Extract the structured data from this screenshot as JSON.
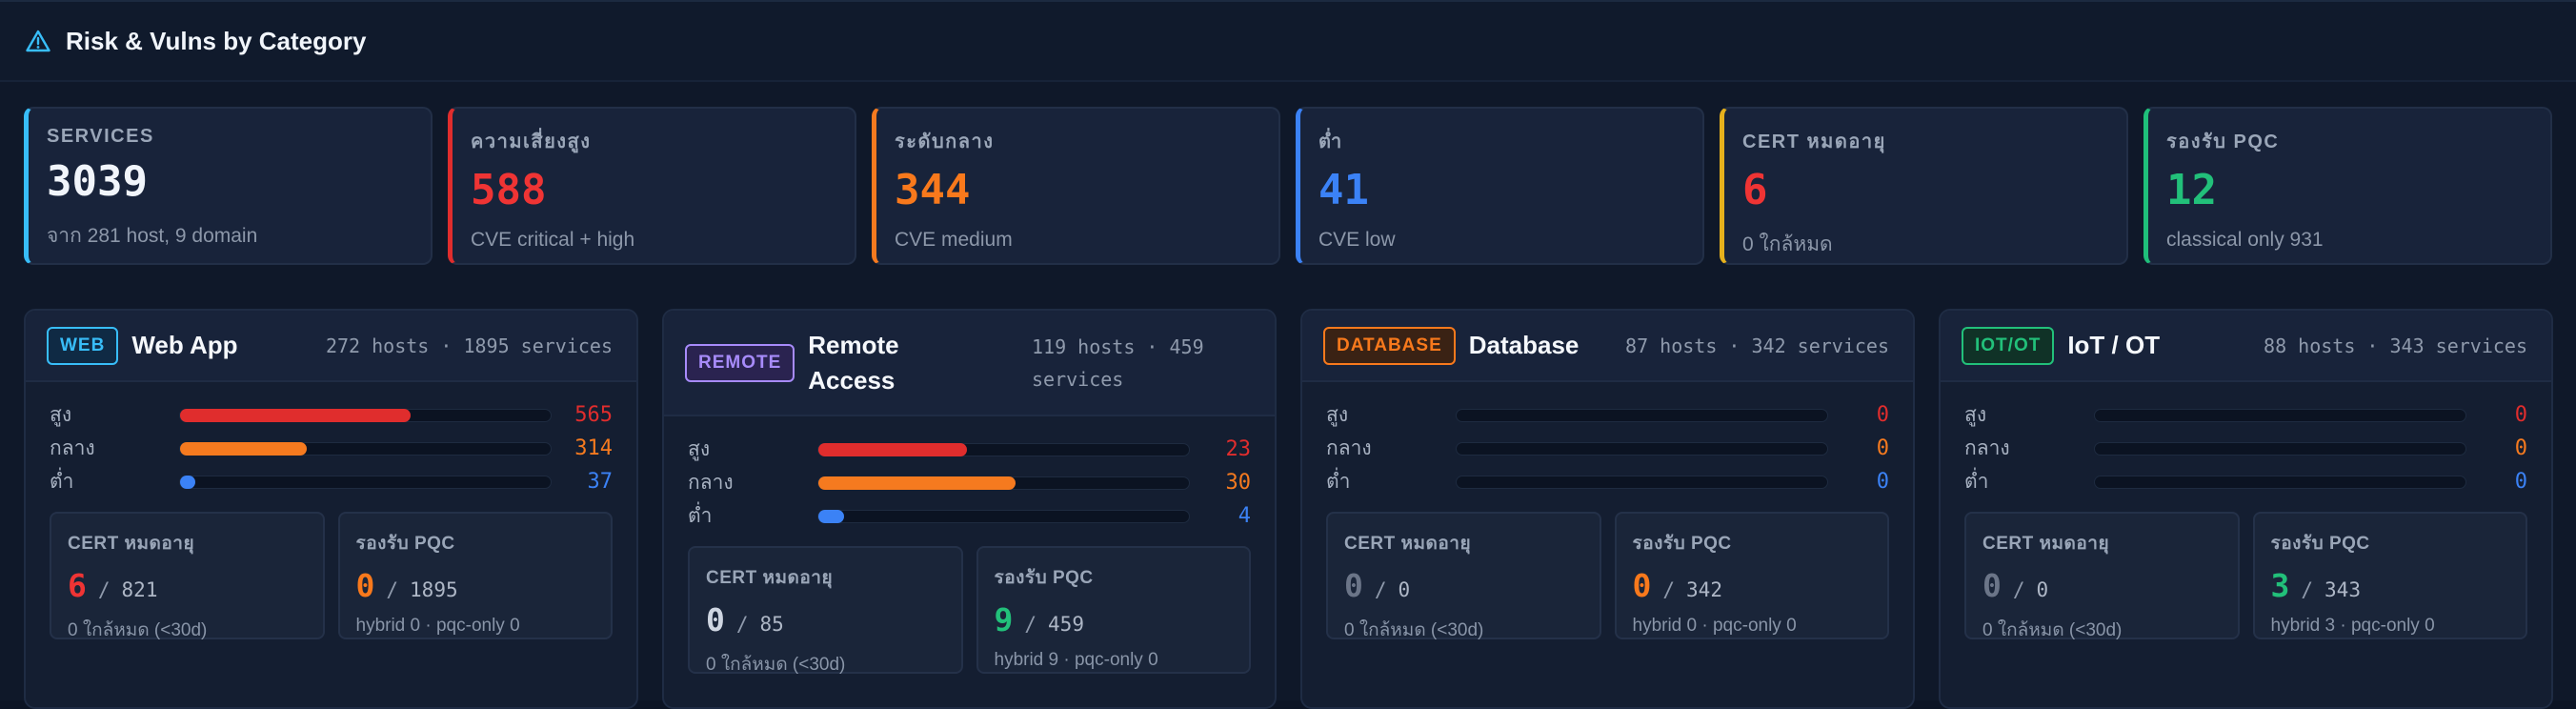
{
  "header": {
    "title": "Risk & Vulns by Category",
    "icon": "warning-triangle-icon"
  },
  "colors": {
    "accent_blue": "#2f9be6",
    "high": "#e02d2d",
    "medium": "#f57a1f",
    "low": "#3b82f6",
    "cert": "#e6b11c",
    "pqc": "#22c07a"
  },
  "stats": [
    {
      "label": "SERVICES",
      "value": "3039",
      "sub": "จาก 281 host, 9 domain",
      "color": "#38bdf8",
      "value_color": "#f1f5fb"
    },
    {
      "label": "ความเสี่ยงสูง",
      "value": "588",
      "sub": "CVE critical + high",
      "color": "#e02d2d",
      "value_color": "#ef3434"
    },
    {
      "label": "ระดับกลาง",
      "value": "344",
      "sub": "CVE medium",
      "color": "#f57a1f",
      "value_color": "#f8791c"
    },
    {
      "label": "ต่ำ",
      "value": "41",
      "sub": "CVE low",
      "color": "#3b82f6",
      "value_color": "#3b82f6"
    },
    {
      "label": "CERT หมดอายุ",
      "value": "6",
      "sub": "0 ใกล้หมด",
      "color": "#e6b11c",
      "value_color": "#ef3434"
    },
    {
      "label": "รองรับ PQC",
      "value": "12",
      "sub": "classical only 931",
      "color": "#1fbf7a",
      "value_color": "#22c07a"
    }
  ],
  "cards": [
    {
      "badge": "WEB",
      "badge_color": "#38bdf8",
      "badge_bg": "#0f2a44",
      "title": "Web App",
      "meta": "272 hosts · 1895 services",
      "bars": [
        {
          "label": "สูง",
          "value": "565",
          "fraction": 0.62
        },
        {
          "label": "กลาง",
          "value": "314",
          "fraction": 0.34
        },
        {
          "label": "ต่ำ",
          "value": "37",
          "fraction": 0.04
        }
      ],
      "cert": {
        "label": "CERT หมดอายุ",
        "count": "6",
        "total": "821",
        "sub": "0 ใกล้หมด (<30d)",
        "color": "#ef3434"
      },
      "pqc": {
        "label": "รองรับ PQC",
        "count": "0",
        "total": "1895",
        "sub": "hybrid 0 · pqc-only 0",
        "color": "#f8791c"
      }
    },
    {
      "badge": "REMOTE",
      "badge_color": "#a78bfa",
      "badge_bg": "#2a2350",
      "title": "Remote Access",
      "meta": "119 hosts · 459 services",
      "bars": [
        {
          "label": "สูง",
          "value": "23",
          "fraction": 0.4
        },
        {
          "label": "กลาง",
          "value": "30",
          "fraction": 0.53
        },
        {
          "label": "ต่ำ",
          "value": "4",
          "fraction": 0.07
        }
      ],
      "cert": {
        "label": "CERT หมดอายุ",
        "count": "0",
        "total": "85",
        "sub": "0 ใกล้หมด (<30d)",
        "color": "#cfd6e2"
      },
      "pqc": {
        "label": "รองรับ PQC",
        "count": "9",
        "total": "459",
        "sub": "hybrid 9 · pqc-only 0",
        "color": "#22c07a"
      }
    },
    {
      "badge": "DATABASE",
      "badge_color": "#f8791c",
      "badge_bg": "#3a2214",
      "title": "Database",
      "meta": "87 hosts · 342 services",
      "bars": [
        {
          "label": "สูง",
          "value": "0",
          "fraction": 0
        },
        {
          "label": "กลาง",
          "value": "0",
          "fraction": 0
        },
        {
          "label": "ต่ำ",
          "value": "0",
          "fraction": 0
        }
      ],
      "cert": {
        "label": "CERT หมดอายุ",
        "count": "0",
        "total": "0",
        "sub": "0 ใกล้หมด (<30d)",
        "color": "#6b7588"
      },
      "pqc": {
        "label": "รองรับ PQC",
        "count": "0",
        "total": "342",
        "sub": "hybrid 0 · pqc-only 0",
        "color": "#f8791c"
      }
    },
    {
      "badge": "IOT/OT",
      "badge_color": "#22c07a",
      "badge_bg": "#103227",
      "title": "IoT / OT",
      "meta": "88 hosts · 343 services",
      "bars": [
        {
          "label": "สูง",
          "value": "0",
          "fraction": 0
        },
        {
          "label": "กลาง",
          "value": "0",
          "fraction": 0
        },
        {
          "label": "ต่ำ",
          "value": "0",
          "fraction": 0
        }
      ],
      "cert": {
        "label": "CERT หมดอายุ",
        "count": "0",
        "total": "0",
        "sub": "0 ใกล้หมด (<30d)",
        "color": "#6b7588"
      },
      "pqc": {
        "label": "รองรับ PQC",
        "count": "3",
        "total": "343",
        "sub": "hybrid 3 · pqc-only 0",
        "color": "#22c07a"
      }
    }
  ]
}
